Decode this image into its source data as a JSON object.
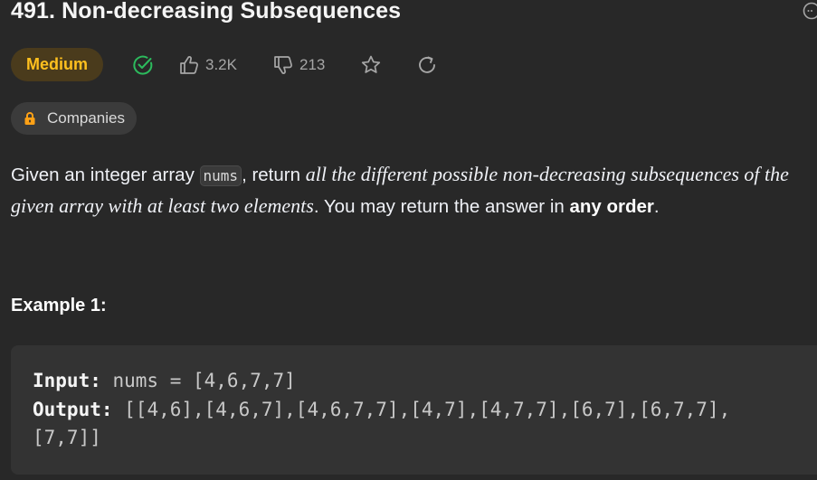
{
  "problem": {
    "title": "491. Non-decreasing Subsequences",
    "difficulty": "Medium",
    "likes": "3.2K",
    "dislikes": "213",
    "companies_label": "Companies"
  },
  "description": {
    "part1": "Given an integer array ",
    "code_nums": "nums",
    "part2": ", return ",
    "italic": "all the different possible non-decreasing subsequences of the given array with at least two elements",
    "part3": ". You may return the answer in ",
    "bold": "any order",
    "part4": "."
  },
  "example": {
    "title": "Example 1:",
    "input_label": "Input:",
    "input_value": " nums = [4,6,7,7]",
    "output_label": "Output:",
    "output_value_line1": " [[4,6],[4,6,7],[4,6,7,7],[4,7],[4,7,7],[6,7],[6,7,7],",
    "output_value_line2": "[7,7]]"
  },
  "colors": {
    "background": "#282828",
    "difficulty_text": "#ffc01e",
    "difficulty_bg": "#4a3b1c",
    "solved_check": "#2cbb5d",
    "lock": "#ffa116"
  },
  "icons": [
    "solved-check-icon",
    "thumbs-up-icon",
    "thumbs-down-icon",
    "star-icon",
    "share-icon",
    "lock-icon",
    "corner-icon"
  ]
}
